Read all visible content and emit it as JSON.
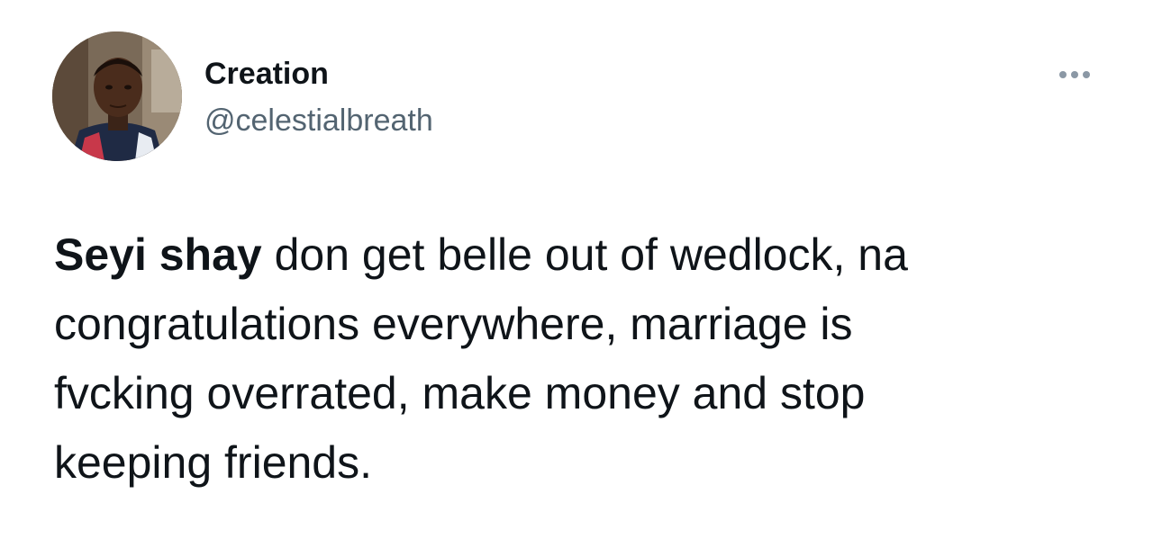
{
  "author": {
    "display_name": "Creation",
    "handle": "@celestialbreath"
  },
  "header": {
    "more_icon": "more-horizontal-icon"
  },
  "tweet": {
    "mention": "Seyi shay",
    "line1_rest": " don get belle out of wedlock, na",
    "line2": "congratulations everywhere, marriage is",
    "line3": "fvcking overrated, make money and stop",
    "line4": "keeping friends."
  },
  "colors": {
    "text_primary": "#0f1419",
    "text_secondary": "#536471",
    "icon_gray": "#8b98a5",
    "background": "#ffffff"
  }
}
